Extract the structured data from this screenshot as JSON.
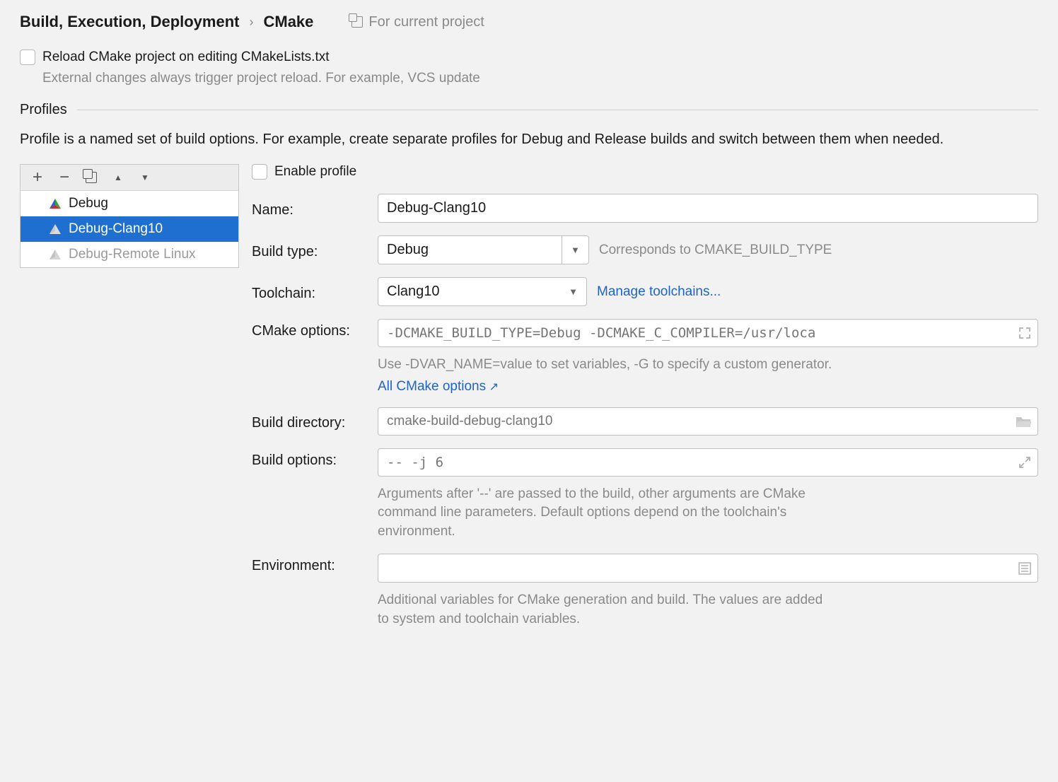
{
  "breadcrumb": {
    "parent": "Build, Execution, Deployment",
    "separator": "›",
    "current": "CMake",
    "scope": "For current project"
  },
  "reload": {
    "label": "Reload CMake project on editing CMakeLists.txt",
    "hint": "External changes always trigger project reload. For example, VCS update"
  },
  "profiles_section": {
    "title": "Profiles",
    "description": "Profile is a named set of build options. For example, create separate profiles for Debug and Release builds and switch between them when needed."
  },
  "profile_list": [
    {
      "name": "Debug",
      "active": true,
      "selected": false
    },
    {
      "name": "Debug-Clang10",
      "active": true,
      "selected": true
    },
    {
      "name": "Debug-Remote Linux",
      "active": false,
      "selected": false
    }
  ],
  "form": {
    "enable_label": "Enable profile",
    "name": {
      "label": "Name:",
      "value": "Debug-Clang10"
    },
    "build_type": {
      "label": "Build type:",
      "value": "Debug",
      "hint": "Corresponds to CMAKE_BUILD_TYPE"
    },
    "toolchain": {
      "label": "Toolchain:",
      "value": "Clang10",
      "link": "Manage toolchains..."
    },
    "cmake_options": {
      "label": "CMake options:",
      "placeholder": "-DCMAKE_BUILD_TYPE=Debug -DCMAKE_C_COMPILER=/usr/loca",
      "hint": "Use -DVAR_NAME=value to set variables, -G to specify a custom generator.",
      "link": "All CMake options"
    },
    "build_directory": {
      "label": "Build directory:",
      "placeholder": "cmake-build-debug-clang10"
    },
    "build_options": {
      "label": "Build options:",
      "placeholder": "-- -j 6",
      "hint": "Arguments after '--' are passed to the build, other arguments are CMake command line parameters. Default options depend on the toolchain's environment."
    },
    "environment": {
      "label": "Environment:",
      "value": "",
      "hint": "Additional variables for CMake generation and build. The values are added to system and toolchain variables."
    }
  }
}
